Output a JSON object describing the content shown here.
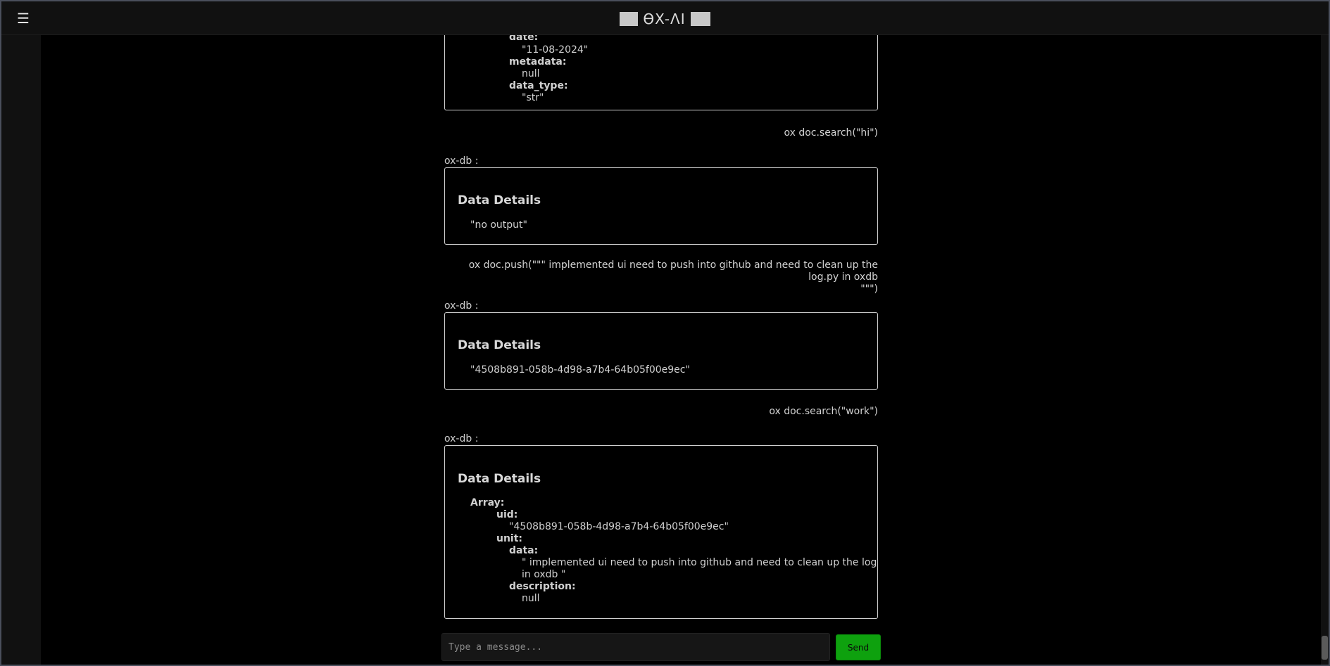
{
  "header": {
    "menu_icon": "☰",
    "brand_text": "ϴX-ΛI"
  },
  "colors": {
    "send_bg": "#0ea10e",
    "background": "#000000",
    "topbar": "#111111"
  },
  "messages": {
    "partial_card": {
      "keys": {
        "date": "date:",
        "metadata": "metadata:",
        "data_type": "data_type:"
      },
      "values": {
        "date": "\"11-08-2024\"",
        "metadata": "null",
        "data_type": "\"str\""
      }
    },
    "user1": "ox doc.search(\"hi\")",
    "bot1": {
      "label": "ox-db :",
      "title": "Data Details",
      "value": "\"no output\""
    },
    "user2_line1": "ox doc.push(\"\"\" implemented ui need to push into github and need to clean up the log.py in oxdb",
    "user2_line2": "\"\"\")",
    "bot2": {
      "label": "ox-db :",
      "title": "Data Details",
      "value": "\"4508b891-058b-4d98-a7b4-64b05f00e9ec\""
    },
    "user3": "ox doc.search(\"work\")",
    "bot3": {
      "label": "ox-db :",
      "title": "Data Details",
      "array_key": "Array:",
      "uid_key": "uid:",
      "uid_value": "\"4508b891-058b-4d98-a7b4-64b05f00e9ec\"",
      "unit_key": "unit:",
      "data_key": "data:",
      "data_value_line1": "\" implemented ui need to push into github and need to clean up the log.py",
      "data_value_line2": "in oxdb \"",
      "description_key": "description:",
      "description_value": "null"
    }
  },
  "composer": {
    "placeholder": "Type a message...",
    "send_label": "Send"
  }
}
